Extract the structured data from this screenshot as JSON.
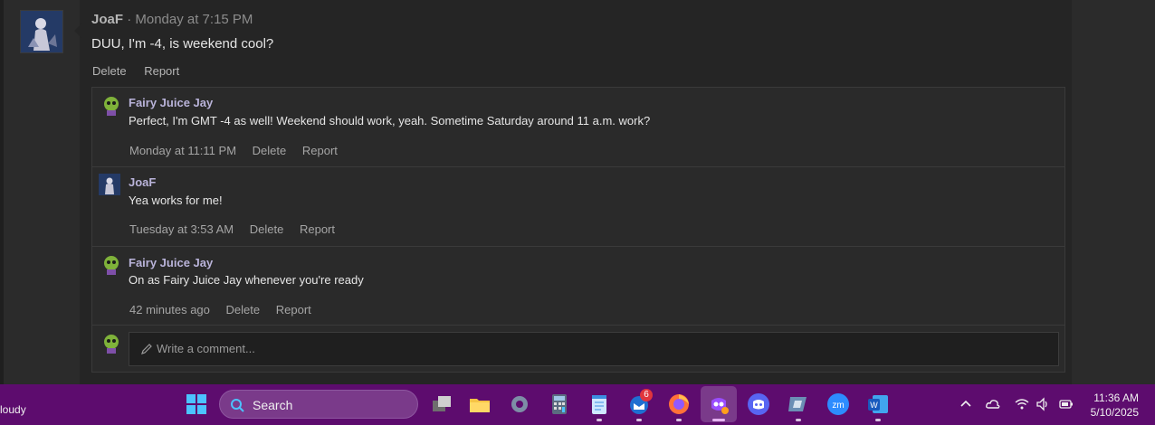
{
  "post": {
    "author": "JoaF",
    "timestamp": "· Monday at 7:15 PM",
    "body": "DUU, I'm -4, is weekend cool?",
    "actions": {
      "delete": "Delete",
      "report": "Report"
    }
  },
  "comments": [
    {
      "author": "Fairy Juice Jay",
      "body": "Perfect, I'm GMT -4 as well! Weekend should work, yeah. Sometime Saturday around 11 a.m. work?",
      "time": "Monday at 11:11 PM",
      "delete": "Delete",
      "report": "Report"
    },
    {
      "author": "JoaF",
      "body": "Yea works for me!",
      "time": "Tuesday at 3:53 AM",
      "delete": "Delete",
      "report": "Report"
    },
    {
      "author": "Fairy Juice Jay",
      "body": "On as Fairy Juice Jay whenever you're ready",
      "time": "42 minutes ago",
      "delete": "Delete",
      "report": "Report"
    }
  ],
  "composer": {
    "placeholder": "Write a comment..."
  },
  "taskbar": {
    "weather": "loudy",
    "search_label": "Search",
    "mail_badge": "6",
    "time": "11:36 AM",
    "date": "5/10/2025",
    "apps": [
      "windows-start-icon",
      "search-icon",
      "task-view-icon",
      "file-explorer-icon",
      "settings-icon",
      "calculator-icon",
      "notepad-icon",
      "mail-icon",
      "firefox-icon",
      "app-icon",
      "discord-icon",
      "app-icon",
      "zoom-icon",
      "word-icon"
    ]
  }
}
